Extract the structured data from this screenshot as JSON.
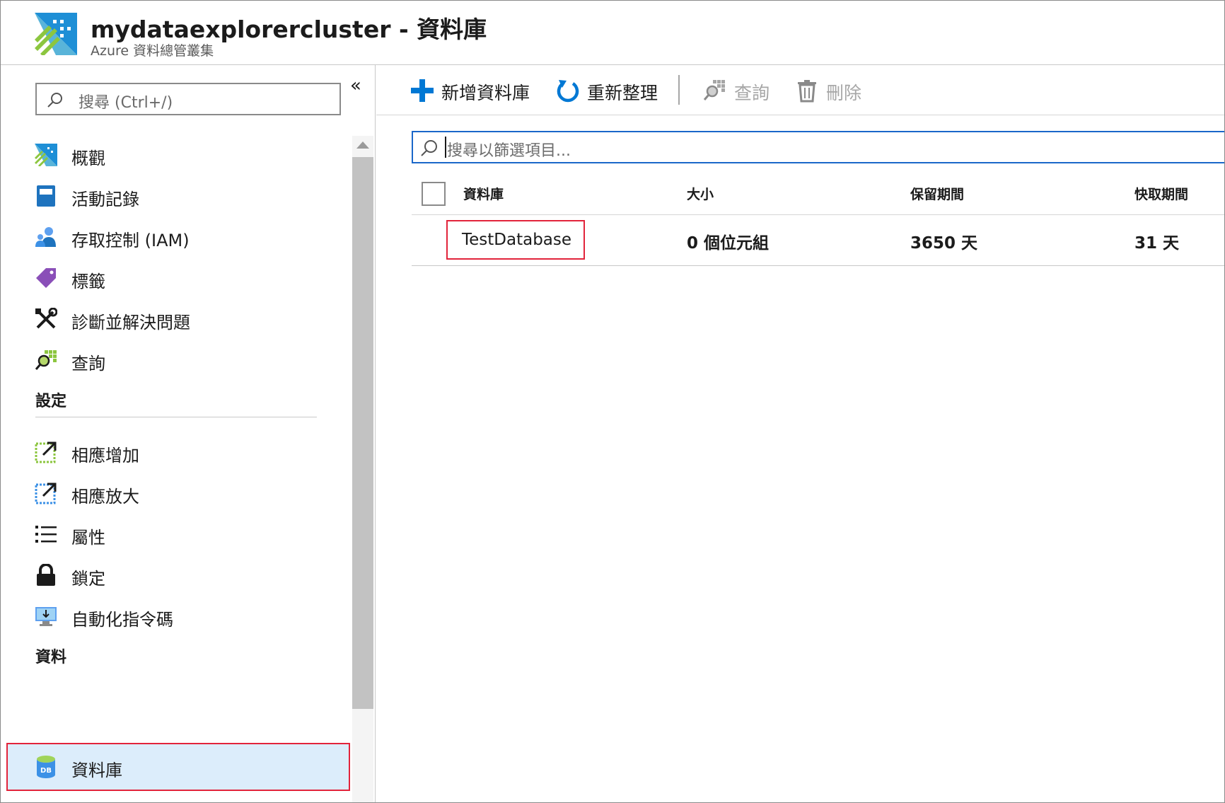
{
  "header": {
    "title": "mydataexplorercluster - 資料庫",
    "subtitle": "Azure 資料總管叢集"
  },
  "sidebar": {
    "search_placeholder": "搜尋 (Ctrl+/)",
    "collapse_glyph": "«",
    "items": [
      {
        "label": "概觀",
        "icon": "overview-icon"
      },
      {
        "label": "活動記錄",
        "icon": "activity-log-icon"
      },
      {
        "label": "存取控制 (IAM)",
        "icon": "access-control-icon"
      },
      {
        "label": "標籤",
        "icon": "tag-icon"
      },
      {
        "label": "診斷並解決問題",
        "icon": "wrench-icon"
      },
      {
        "label": "查詢",
        "icon": "query-icon"
      }
    ],
    "settings_header": "設定",
    "settings_items": [
      {
        "label": "相應增加",
        "icon": "scale-up-icon"
      },
      {
        "label": "相應放大",
        "icon": "scale-out-icon"
      },
      {
        "label": "屬性",
        "icon": "properties-icon"
      },
      {
        "label": "鎖定",
        "icon": "lock-icon"
      },
      {
        "label": "自動化指令碼",
        "icon": "automation-script-icon"
      }
    ],
    "data_header": "資料",
    "data_items": [
      {
        "label": "資料庫",
        "icon": "database-icon",
        "icon_text": "DB",
        "selected": true
      }
    ]
  },
  "toolbar": {
    "add_label": "新增資料庫",
    "refresh_label": "重新整理",
    "query_label": "查詢",
    "delete_label": "刪除"
  },
  "filter": {
    "placeholder": "搜尋以篩選項目..."
  },
  "table": {
    "columns": [
      "資料庫",
      "大小",
      "保留期間",
      "快取期間"
    ],
    "rows": [
      {
        "name": "TestDatabase",
        "size": "0 個位元組",
        "retention": "3650 天",
        "cache": "31 天"
      }
    ]
  },
  "colors": {
    "accent": "#0078d4",
    "highlight_border": "#e2243b",
    "selected_bg": "#dcedfb"
  }
}
